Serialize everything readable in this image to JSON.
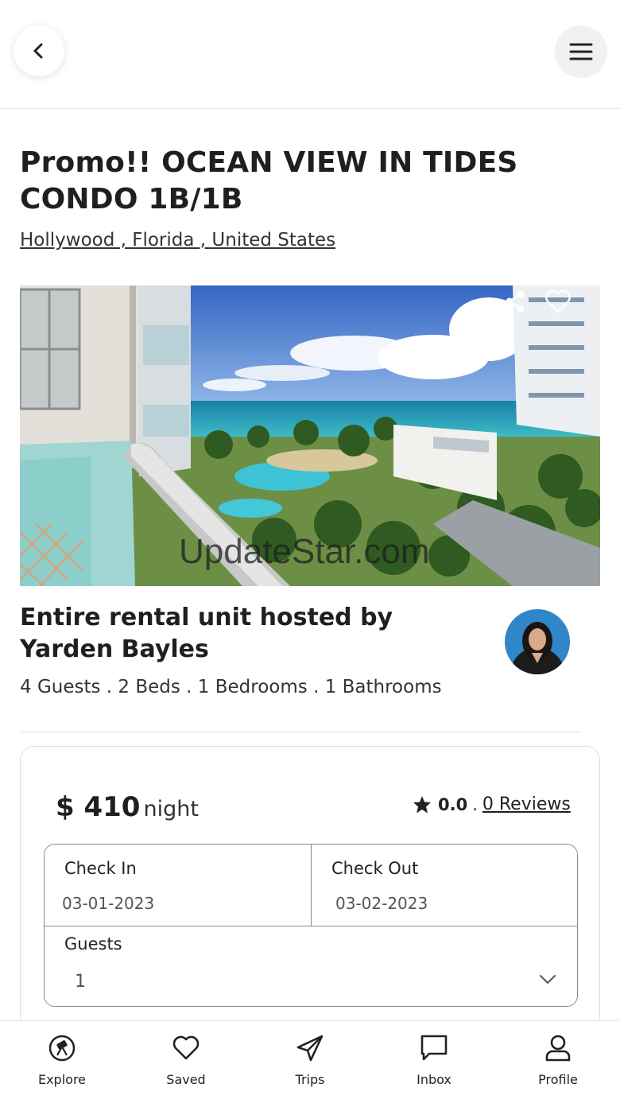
{
  "header": {
    "back_icon": "chevron-left-icon",
    "menu_icon": "hamburger-menu-icon"
  },
  "listing": {
    "title": "Promo!! OCEAN VIEW IN TIDES CONDO 1B/1B",
    "location": "Hollywood , Florida , United States",
    "photo_watermark": "UpdateStar.com",
    "host_title": "Entire rental unit hosted by Yarden Bayles",
    "specs": "4 Guests . 2 Beds . 1 Bedrooms . 1 Bathrooms"
  },
  "booking": {
    "price": "$ 410",
    "price_unit": "night",
    "rating": "0.0",
    "rating_separator": ".",
    "reviews": "0 Reviews",
    "check_in_label": "Check In",
    "check_in_value": "03-01-2023",
    "check_out_label": "Check Out",
    "check_out_value": "03-02-2023",
    "guests_label": "Guests",
    "guests_value": "1"
  },
  "nav": {
    "items": [
      {
        "label": "Explore",
        "icon": "explore-icon"
      },
      {
        "label": "Saved",
        "icon": "heart-icon"
      },
      {
        "label": "Trips",
        "icon": "paper-plane-icon"
      },
      {
        "label": "Inbox",
        "icon": "message-icon"
      },
      {
        "label": "Profile",
        "icon": "user-icon"
      }
    ]
  },
  "colors": {
    "text": "#1f1f1f",
    "border": "#8a8a8a",
    "sky": "#3f73c9",
    "ocean": "#1fa6b8"
  }
}
